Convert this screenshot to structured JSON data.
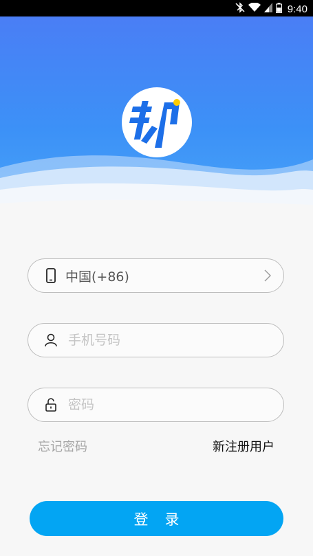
{
  "status_bar": {
    "time": "9:40",
    "icons": [
      "bluetooth-muted-icon",
      "wifi-icon",
      "signal-icon",
      "battery-icon"
    ]
  },
  "logo": {
    "glyph": "邦",
    "color": "#1d6fe8"
  },
  "country_selector": {
    "value": "中国(+86)"
  },
  "phone_input": {
    "placeholder": "手机号码",
    "value": ""
  },
  "password_input": {
    "placeholder": "密码",
    "value": ""
  },
  "links": {
    "forgot": "忘记密码",
    "register": "新注册用户"
  },
  "login_button": {
    "label": "登录"
  },
  "colors": {
    "hero_top": "#4a7ef5",
    "hero_bottom": "#4aa6f8",
    "button": "#03a5f3",
    "background": "#f7f7f7"
  }
}
